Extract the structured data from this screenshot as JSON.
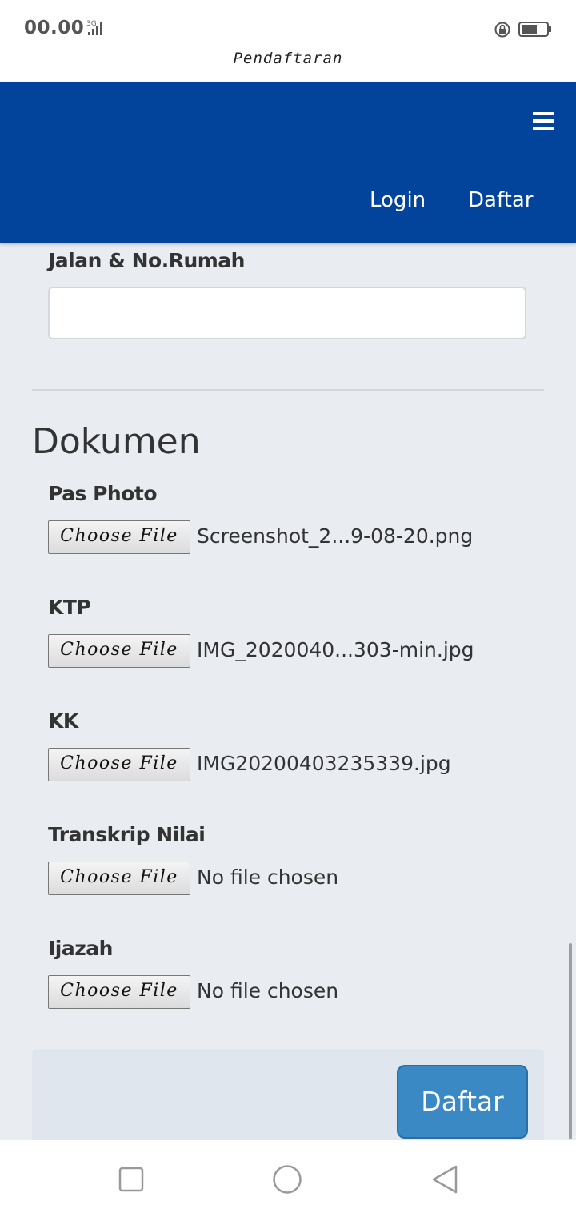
{
  "status_bar": {
    "time": "00.00",
    "network": "3G"
  },
  "page_heading": "Pendaftaran",
  "navbar": {
    "login": "Login",
    "daftar": "Daftar"
  },
  "address_field": {
    "label": "Jalan & No.Rumah",
    "value": "",
    "placeholder": ""
  },
  "section_title": "Dokumen",
  "file_button_label": "Choose File",
  "documents": [
    {
      "label": "Pas Photo",
      "file": "Screenshot_2...9-08-20.png"
    },
    {
      "label": "KTP",
      "file": "IMG_2020040...303-min.jpg"
    },
    {
      "label": "KK",
      "file": "IMG20200403235339.jpg"
    },
    {
      "label": "Transkrip Nilai",
      "file": "No file chosen"
    },
    {
      "label": "Ijazah",
      "file": "No file chosen"
    }
  ],
  "submit_label": "Daftar",
  "colors": {
    "navbar": "#02449b",
    "button": "#3a89c4",
    "background": "#e9ecf1"
  }
}
